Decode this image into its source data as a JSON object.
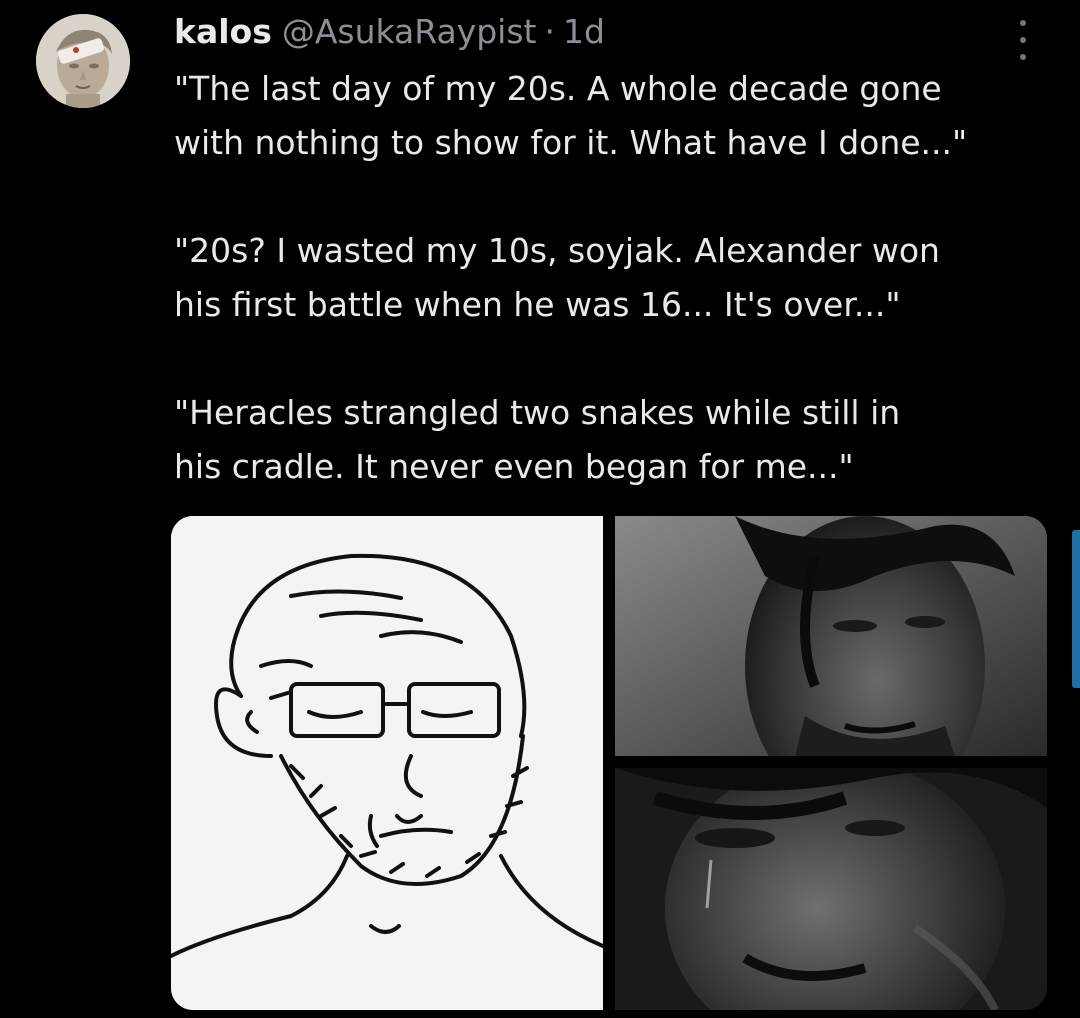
{
  "tweet": {
    "display_name": "kalos",
    "handle": "@AsukaRaypist",
    "separator": "·",
    "time": "1d",
    "lines": [
      "\"The last day of my 20s. A whole decade gone",
      "with nothing to show for it. What have I done...\"",
      "\"20s? I wasted my 10s, soyjak. Alexander won",
      "his first battle when he was 16... It's over...\"",
      "\"Heracles strangled two snakes while still in",
      "his cradle. It never even began for me...\""
    ]
  },
  "icons": {
    "more": "more-horizontal-icon"
  },
  "colors": {
    "background": "#000000",
    "text": "#e7e9ea",
    "secondary_text": "#8b9096",
    "accent": "#1d6fa8"
  }
}
